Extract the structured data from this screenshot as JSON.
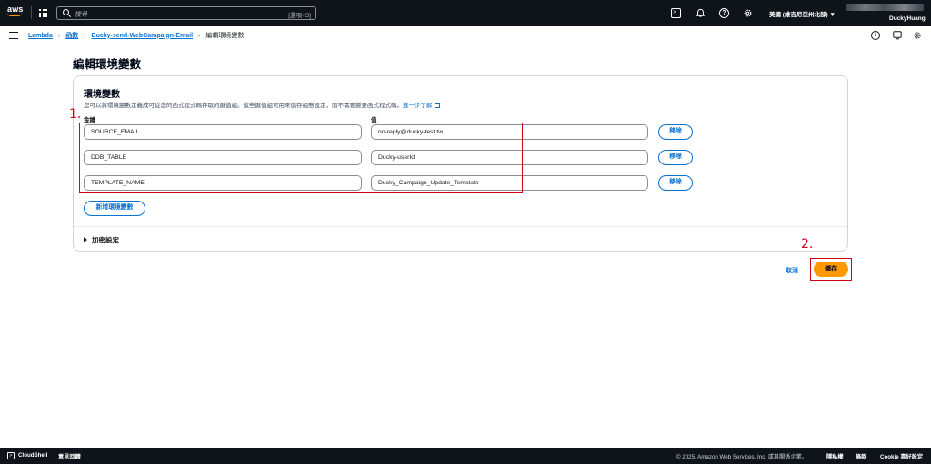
{
  "topnav": {
    "logo_text": "aws",
    "search_placeholder": "搜尋",
    "search_shortcut": "[選項+S]",
    "region": "美國 (維吉尼亞州北部) ▼",
    "user": "DuckyHuang"
  },
  "breadcrumb": {
    "items": [
      "Lambda",
      "函數",
      "Ducky-send-WebCampaign-Email",
      "編輯環境變數"
    ]
  },
  "page": {
    "title": "編輯環境變數"
  },
  "panel": {
    "heading": "環境變數",
    "description": "您可以將環境變數定義成可從您的函式程式碼存取的鍵值組。這些鍵值組可用來儲存組態設定，而不需要變更函式程式碼。",
    "learn_more": "進一步了解",
    "key_label": "金鑰",
    "value_label": "值",
    "remove_label": "移除",
    "add_label": "新增環境變數",
    "encryption_label": "加密設定",
    "variables": [
      {
        "key": "SOURCE_EMAIL",
        "value": "no-reply@ducky-test.tw"
      },
      {
        "key": "DDB_TABLE",
        "value": "Ducky-userId"
      },
      {
        "key": "TEMPLATE_NAME",
        "value": "Ducky_Campaign_Update_Template"
      }
    ]
  },
  "actions": {
    "cancel": "取消",
    "save": "儲存"
  },
  "annotations": {
    "one": "1.",
    "two": "2."
  },
  "footer": {
    "cloudshell": "CloudShell",
    "feedback": "意見回饋",
    "copyright": "© 2025, Amazon Web Services, Inc. 或其關係企業。",
    "privacy": "隱私權",
    "terms": "條款",
    "cookie": "Cookie 喜好設定"
  },
  "colors": {
    "nav_bg": "#0f141a",
    "link": "#0972d3",
    "primary": "#ff9900",
    "annotation": "#d0021b"
  }
}
